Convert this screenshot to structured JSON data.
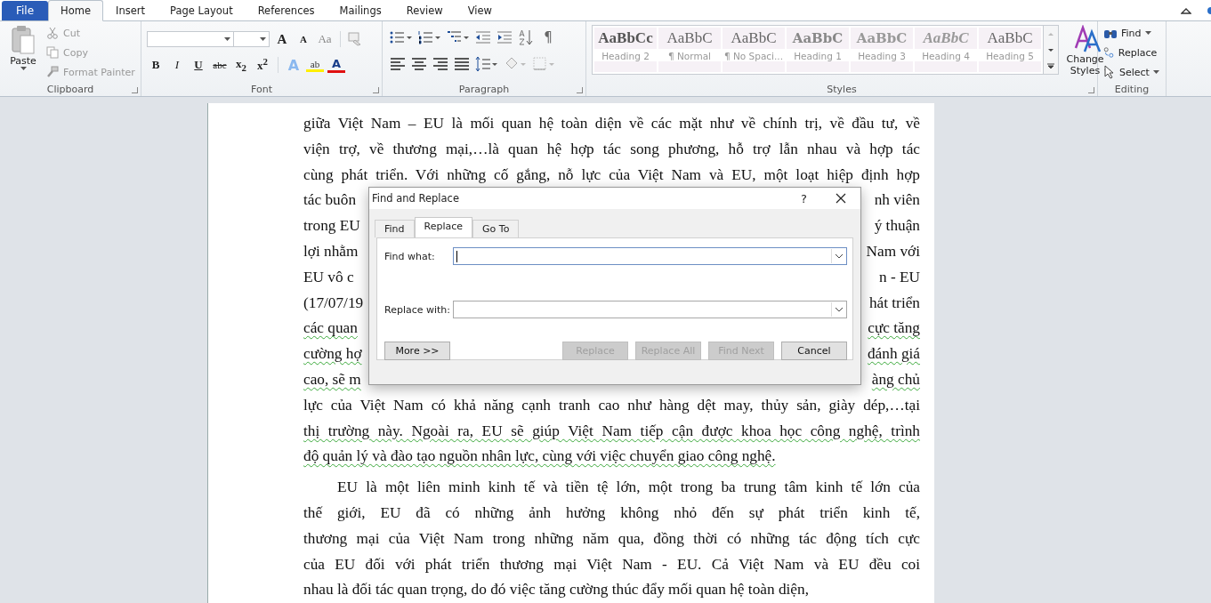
{
  "tabs": [
    {
      "label": "File",
      "kind": "file",
      "selected": false
    },
    {
      "label": "Home",
      "kind": "tab",
      "selected": true
    },
    {
      "label": "Insert",
      "kind": "tab",
      "selected": false
    },
    {
      "label": "Page Layout",
      "kind": "tab",
      "selected": false
    },
    {
      "label": "References",
      "kind": "tab",
      "selected": false
    },
    {
      "label": "Mailings",
      "kind": "tab",
      "selected": false
    },
    {
      "label": "Review",
      "kind": "tab",
      "selected": false
    },
    {
      "label": "View",
      "kind": "tab",
      "selected": false
    }
  ],
  "clipboard": {
    "group_label": "Clipboard",
    "paste": "Paste",
    "items": [
      {
        "label": "Cut",
        "kind": "cut",
        "disabled": true
      },
      {
        "label": "Copy",
        "kind": "copy",
        "disabled": true
      },
      {
        "label": "Format Painter",
        "kind": "painter",
        "disabled": true
      }
    ]
  },
  "font": {
    "group_label": "Font",
    "size_buttons": [
      {
        "glyph": "A",
        "kind": "grow"
      },
      {
        "glyph": "A",
        "kind": "shrink"
      },
      {
        "glyph": "Aa",
        "kind": "case"
      }
    ],
    "format_buttons": [
      {
        "glyph": "B",
        "kind": "bold"
      },
      {
        "glyph": "I",
        "kind": "italic"
      },
      {
        "glyph": "U",
        "kind": "underline"
      },
      {
        "glyph": "abc",
        "kind": "strike"
      },
      {
        "glyph": "x$_{2}$",
        "kind": "sub"
      },
      {
        "glyph": "x$^{2}$",
        "kind": "sup"
      }
    ],
    "color_buttons": [
      {
        "glyph": "A",
        "kind": "effects"
      },
      {
        "glyph": "ab",
        "kind": "highlight"
      },
      {
        "glyph": "A",
        "kind": "color"
      }
    ]
  },
  "paragraph": {
    "group_label": "Paragraph",
    "marks_glyph": "¶"
  },
  "styles": {
    "group_label": "Styles",
    "items": [
      {
        "preview": "AaBbCc",
        "name": "Heading 2",
        "kind": "heading2"
      },
      {
        "preview": "AaBbC",
        "name": "¶ Normal",
        "kind": "normal"
      },
      {
        "preview": "AaBbC",
        "name": "¶ No Spaci...",
        "kind": "normal"
      },
      {
        "preview": "AaBbC",
        "name": "Heading 1",
        "kind": "heading1"
      },
      {
        "preview": "AaBbC",
        "name": "Heading 3",
        "kind": "heading3"
      },
      {
        "preview": "AaBbC",
        "name": "Heading 4",
        "kind": "heading4"
      },
      {
        "preview": "AaBbC",
        "name": "Heading 5",
        "kind": "normal"
      }
    ],
    "change_styles": "Change Styles"
  },
  "editing": {
    "group_label": "Editing",
    "items": [
      {
        "label": "Find",
        "kind": "find",
        "dropdown": true
      },
      {
        "label": "Replace",
        "kind": "replace",
        "dropdown": false
      },
      {
        "label": "Select",
        "kind": "select",
        "dropdown": true
      }
    ]
  },
  "document": {
    "paragraphs": [
      {
        "indent": false,
        "lines": [
          {
            "text": "giữa Việt Nam – EU là mối quan hệ toàn diện về các mặt như về chính trị, về đầu tư, về",
            "squiggle": false
          },
          {
            "text": "viện trợ, về thương mại,…là quan hệ hợp tác song phương, hỗ trợ lẫn nhau và hợp tác",
            "squiggle": false
          },
          {
            "text": "cùng phát triển. Với những cố gắng, nỗ lực của Việt Nam và EU, một loạt hiệp định hợp",
            "squiggle": false
          },
          {
            "left": "tác buôn",
            "right": "nh viên",
            "squiggle": false
          },
          {
            "left": "trong EU",
            "right": "ý thuận",
            "squiggle": false
          },
          {
            "left": "lợi nhằm",
            "right": "Nam với",
            "squiggle": false
          },
          {
            "left": "EU vô c",
            "right": "n - EU",
            "squiggle": false
          },
          {
            "left": "(17/07/19",
            "right": "hát triển",
            "squiggle": false
          },
          {
            "left": "các quan",
            "right": "cực tăng",
            "squiggle": true
          },
          {
            "left": "cường hợ",
            "right": "đánh giá",
            "squiggle": true
          },
          {
            "left": "cao, sẽ m",
            "right": "àng chủ",
            "squiggle": true
          },
          {
            "text": "lực của Việt Nam có khả năng cạnh tranh cao như hàng dệt may, thủy sản, giày dép,…tại",
            "squiggle": false
          },
          {
            "text": "thị trường này. Ngoài ra, EU sẽ giúp Việt Nam tiếp cận được khoa học công nghệ, trình",
            "squiggle": true
          },
          {
            "text": "độ quản lý và đào tạo nguồn nhân lực, cùng với việc chuyển giao công nghệ.",
            "squiggle": true
          }
        ]
      },
      {
        "indent": true,
        "lines": [
          {
            "text": "EU là một liên minh kinh tế và tiền tệ lớn, một trong ba trung tâm kinh tế lớn của",
            "squiggle": false
          },
          {
            "text": "thế giới, EU đã có những ảnh hưởng không nhỏ đến sự phát triển kinh tế,",
            "squiggle": false
          },
          {
            "text": "thương mại của Việt Nam trong những năm qua, đồng thời có những tác động tích cực",
            "squiggle": false
          },
          {
            "text": "của EU đối với phát triển thương mại Việt Nam - EU. Cả Việt Nam và EU đều coi",
            "squiggle": false
          },
          {
            "text": "nhau là đối tác quan trọng, do đó việc tăng cường thúc đẩy mối quan hệ toàn diện,",
            "squiggle": false
          }
        ]
      }
    ]
  },
  "dialog": {
    "title": "Find and Replace",
    "help": "?",
    "tabs": [
      {
        "label": "Find",
        "selected": false
      },
      {
        "label": "Replace",
        "selected": true
      },
      {
        "label": "Go To",
        "selected": false
      }
    ],
    "fields": [
      {
        "label": "Find what:",
        "focused": true
      },
      {
        "label": "Replace with:",
        "focused": false
      }
    ],
    "buttons": [
      {
        "label": "More >>",
        "kind": "more",
        "disabled": false
      },
      {
        "label": "Replace",
        "kind": "action",
        "disabled": true
      },
      {
        "label": "Replace All",
        "kind": "action",
        "disabled": true
      },
      {
        "label": "Find Next",
        "kind": "action",
        "disabled": true
      },
      {
        "label": "Cancel",
        "kind": "action",
        "disabled": false
      }
    ]
  }
}
